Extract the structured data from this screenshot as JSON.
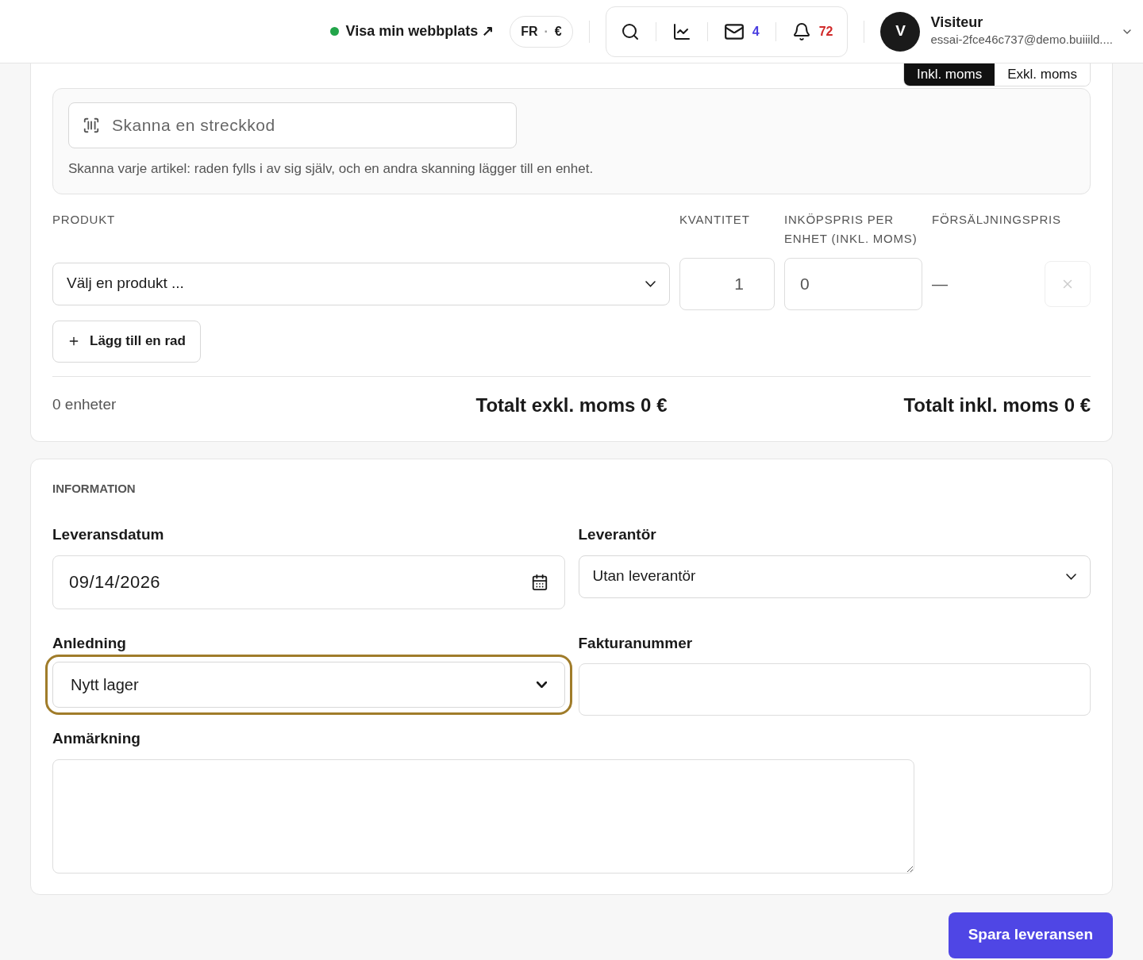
{
  "header": {
    "site_link": "Visa min webbplats ↗",
    "site_online": true,
    "locale": "FR",
    "separator": "·",
    "currency": "€",
    "mail_count": "4",
    "notification_count": "72",
    "user": {
      "initial": "V",
      "name": "Visiteur",
      "email": "essai-2fce46c737@demo.buiiild...."
    }
  },
  "products": {
    "vat_toggle": [
      {
        "label": "Inkl. moms",
        "selected": true
      },
      {
        "label": "Exkl. moms",
        "selected": false
      }
    ],
    "scan": {
      "placeholder": "Skanna en streckkod",
      "hint": "Skanna varje artikel: raden fylls i av sig själv, och en andra skanning lägger till en enhet."
    },
    "columns": [
      "PRODUKT",
      "KVANTITET",
      "INKÖPSPRIS PER ENHET (INKL. MOMS)",
      "FÖRSÄLJNINGSPRIS"
    ],
    "rows": [
      {
        "product": "Välj en produkt ...",
        "quantity": "1",
        "price": "0",
        "sale_price": "—"
      }
    ],
    "add_row": "Lägg till en rad",
    "units": "0 enheter",
    "total_excl": "Totalt exkl. moms 0 €",
    "total_incl": "Totalt inkl. moms 0 €"
  },
  "information": {
    "title": "INFORMATION",
    "delivery_date": {
      "label": "Leveransdatum",
      "value": "09/14/2026"
    },
    "supplier": {
      "label": "Leverantör",
      "value": "Utan leverantör"
    },
    "reason": {
      "label": "Anledning",
      "value": "Nytt lager",
      "focused": true
    },
    "invoice": {
      "label": "Fakturanummer"
    },
    "note": {
      "label": "Anmärkning"
    }
  },
  "save_button": "Spara leveransen"
}
